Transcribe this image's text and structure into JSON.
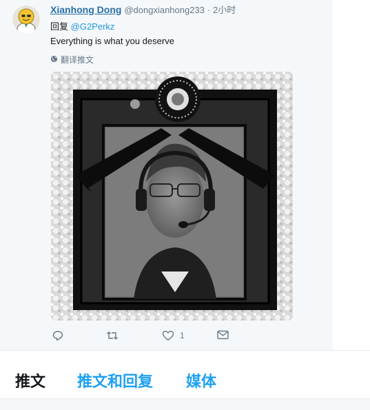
{
  "tweet": {
    "display_name": "Xianhong Dong",
    "handle": "@dongxianhong233",
    "separator": "·",
    "time": "2小时",
    "reply_prefix": "回复",
    "reply_to": "@G2Perkz",
    "text": "Everything is what you deserve",
    "translate_label": "翻译推文",
    "like_count": "1"
  },
  "icons": {
    "reply": "reply-icon",
    "retweet": "retweet-icon",
    "like": "heart-icon",
    "message": "envelope-icon",
    "globe": "globe-icon"
  },
  "tabs": [
    {
      "label": "推文"
    },
    {
      "label": "推文和回复"
    },
    {
      "label": "媒体"
    }
  ],
  "colors": {
    "link": "#1da1f2",
    "muted": "#657786",
    "card_bg": "#f5f8fa"
  }
}
